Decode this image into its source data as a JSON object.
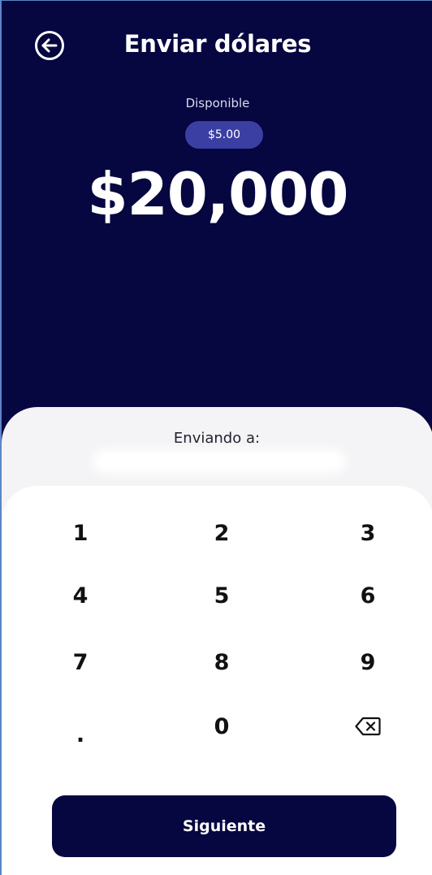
{
  "header": {
    "title": "Enviar dólares",
    "back_icon": "arrow-left-circle-icon"
  },
  "balance": {
    "label": "Disponible",
    "value": "$5.00"
  },
  "amount": {
    "value": "$20,000"
  },
  "recipient": {
    "label": "Enviando a:"
  },
  "keypad": {
    "keys": [
      "1",
      "2",
      "3",
      "4",
      "5",
      "6",
      "7",
      "8",
      "9",
      ".",
      "0"
    ],
    "backspace_icon": "backspace-icon"
  },
  "actions": {
    "next_label": "Siguiente"
  },
  "colors": {
    "primary": "#060640",
    "pill": "#3b3fa3",
    "surface": "#ffffff",
    "sheet": "#f4f4f6"
  }
}
